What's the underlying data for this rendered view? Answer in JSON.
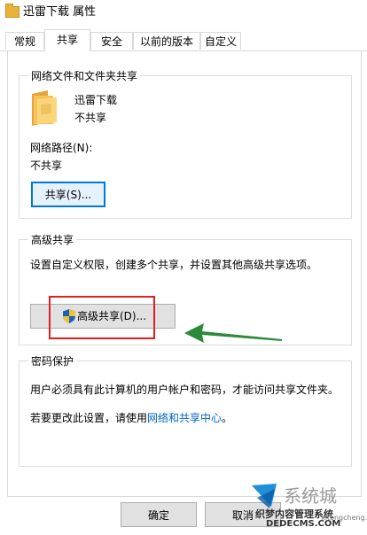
{
  "window": {
    "title": "迅雷下载 属性"
  },
  "tabs": [
    {
      "label": "常规"
    },
    {
      "label": "共享"
    },
    {
      "label": "安全"
    },
    {
      "label": "以前的版本"
    },
    {
      "label": "自定义"
    }
  ],
  "network_sharing": {
    "group_title": "网络文件和文件夹共享",
    "folder_name": "迅雷下载",
    "status": "不共享",
    "path_label": "网络路径(N):",
    "path_value": "不共享",
    "share_button": "共享(S)..."
  },
  "advanced_sharing": {
    "group_title": "高级共享",
    "description": "设置自定义权限，创建多个共享，并设置其他高级共享选项。",
    "button": "高级共享(D)..."
  },
  "password_protection": {
    "group_title": "密码保护",
    "description": "用户必须具有此计算机的用户帐户和密码，才能访问共享文件夹。",
    "change_prefix": "若要更改此设置，请使用",
    "link": "网络和共享中心",
    "change_suffix": "。"
  },
  "footer": {
    "ok": "确定",
    "cancel": "取消"
  },
  "watermark": {
    "line1": "系统城",
    "line2": "织梦内容管理系统",
    "line3": "DEDECMS.COM",
    "line4": "xitongcheng.com"
  },
  "colors": {
    "accent": "#0078d7",
    "highlight_box": "#e02020",
    "arrow": "#2a8a3a",
    "link": "#0066cc"
  }
}
